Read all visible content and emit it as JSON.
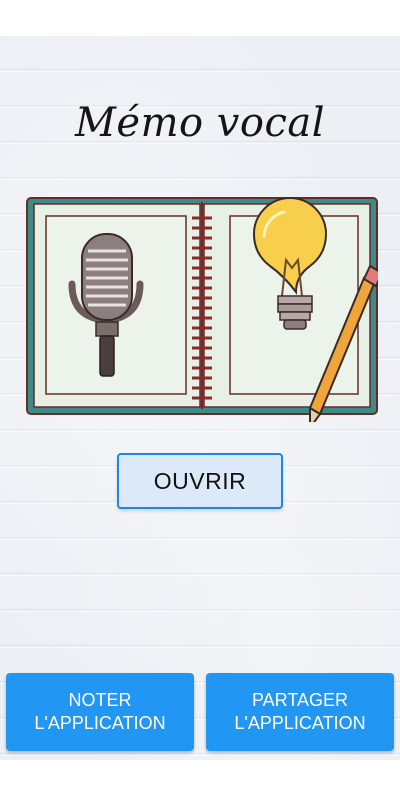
{
  "app": {
    "title": "Mémo vocal"
  },
  "illustration": {
    "name": "notebook-with-microphone-and-lightbulb",
    "colors": {
      "cover": "#3b8c88",
      "page": "#e7f0e5",
      "spiral": "#8a2a2a",
      "bulb": "#f7cf4d",
      "pencil": "#f0a53a"
    }
  },
  "main": {
    "open_label": "OUVRIR"
  },
  "footer": {
    "rate_label": "NOTER\nL'APPLICATION",
    "share_label": "PARTAGER\nL'APPLICATION"
  },
  "colors": {
    "accent": "#2196f3",
    "open_button_bg": "#dbe9f8",
    "open_button_border": "#1e88e5"
  }
}
